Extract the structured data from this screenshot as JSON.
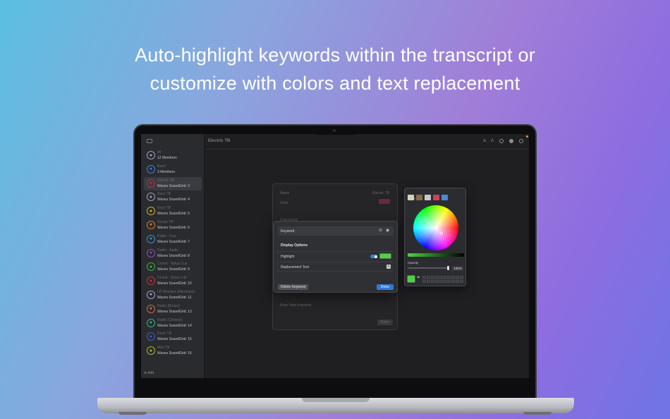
{
  "headline": {
    "line1": "Auto-highlight keywords within the transcript or",
    "line2": "customize with colors and text replacement"
  },
  "window": {
    "title": "Electric TB",
    "toolbar_icons": [
      "export-icon",
      "text-size-icon",
      "info-icon",
      "settings-icon",
      "add-icon"
    ]
  },
  "sidebar": {
    "add_label": "Add",
    "items": [
      {
        "name": "All",
        "sub": "12 Members",
        "color": "#9aa0b8"
      },
      {
        "name": "Band",
        "sub": "3 Members",
        "color": "#3a7ed8"
      },
      {
        "name": "Electric TB",
        "sub": "Waves SoundGrid: 3",
        "color": "#b0304a"
      },
      {
        "name": "Bass TB",
        "sub": "Waves SoundGrid: 4",
        "color": "#9aa0b8"
      },
      {
        "name": "Keys TB",
        "sub": "Waves SoundGrid: 5",
        "color": "#c8b030"
      },
      {
        "name": "Vocals TB",
        "sub": "Waves SoundGrid: 6",
        "color": "#d07a30"
      },
      {
        "name": "Radio - Cue",
        "sub": "Waves SoundGrid: 7",
        "color": "#3a90c8"
      },
      {
        "name": "Radio - Audio",
        "sub": "Waves SoundGrid: 8",
        "color": "#8a4ac0"
      },
      {
        "name": "Crowd - Setup Cue",
        "sub": "Waves SoundGrid: 9",
        "color": "#3ab050"
      },
      {
        "name": "Crowd - Show Call",
        "sub": "Waves SoundGrid: 10",
        "color": "#c83040"
      },
      {
        "name": "LD Headset (Mandrake)",
        "sub": "Waves SoundGrid: 11",
        "color": "#9aa0b8"
      },
      {
        "name": "Radio (Bruise)",
        "sub": "Waves SoundGrid: 13",
        "color": "#c07040"
      },
      {
        "name": "Radio (Chinese)",
        "sub": "Waves SoundGrid: 14",
        "color": "#3ab080"
      },
      {
        "name": "Drum TB",
        "sub": "Waves SoundGrid: 15",
        "color": "#3a60c8"
      },
      {
        "name": "Mon TB",
        "sub": "Waves SoundGrid: 16",
        "color": "#b0b030"
      }
    ]
  },
  "sheet": {
    "name_label": "Name",
    "name_value": "Electric TB",
    "color_label": "Color",
    "connection_label": "Connection",
    "new_keyword_placeholder": "Enter New Keyword",
    "done_label": "Done",
    "color_value": "#6a2a3c"
  },
  "keyword_popover": {
    "keyword_label": "Keyword",
    "section_title": "Display Options",
    "highlight_label": "Highlight",
    "highlight_on": true,
    "highlight_color": "#4cd43e",
    "replacement_label": "Replacement Text",
    "delete_label": "Delete Keyword",
    "done_label": "Done"
  },
  "color_picker": {
    "opacity_label": "Opacity",
    "opacity_value": "100%",
    "current_color": "#4cd43e",
    "tab_colors": [
      "#d8d0b8",
      "#8a6a4a",
      "#c8c8c8",
      "#d04060",
      "#4a8ad8"
    ]
  }
}
